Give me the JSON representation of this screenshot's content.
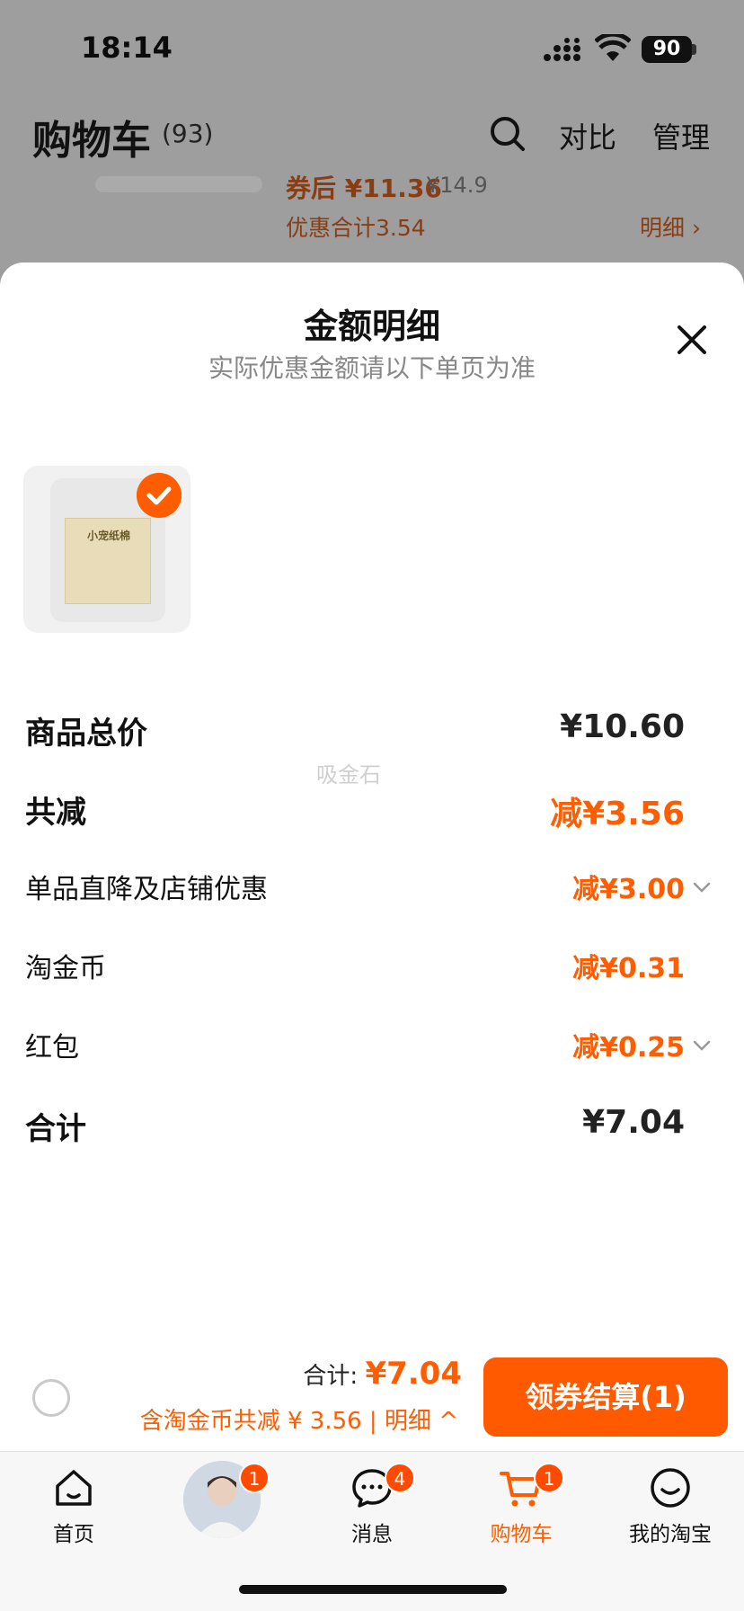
{
  "status_bar": {
    "time": "18:14",
    "battery": "90"
  },
  "background_page": {
    "title": "购物车",
    "count": "(93)",
    "compare_label": "对比",
    "manage_label": "管理",
    "coupon_price": "券后 ¥11.36",
    "original_price": "¥14.9",
    "discount_total": "优惠合计3.54",
    "detail_link": "明细 ›"
  },
  "sheet": {
    "title": "金额明细",
    "subtitle": "实际优惠金额请以下单页为准",
    "product": {
      "label": "小宠纸棉",
      "selected": true
    },
    "rows": [
      {
        "label": "商品总价",
        "value": "¥10.60",
        "emphasis": "bold"
      },
      {
        "label": "共减",
        "value": "减¥3.56",
        "emphasis": "bold-orange"
      },
      {
        "label": "单品直降及店铺优惠",
        "value": "减¥3.00",
        "expandable": true
      },
      {
        "label": "淘金币",
        "value": "减¥0.31",
        "expandable": false
      },
      {
        "label": "红包",
        "value": "减¥0.25",
        "expandable": true
      },
      {
        "label": "合计",
        "value": "¥7.04",
        "emphasis": "bold"
      }
    ],
    "watermark": "吸金石"
  },
  "checkout": {
    "total_label": "合计: ",
    "total_amount": "¥7.04",
    "savings_text": "含淘金币共减 ¥ 3.56 | 明细 ^",
    "button_label": "领券结算(1)"
  },
  "tabs": [
    {
      "label": "首页",
      "icon": "home-icon",
      "badge": ""
    },
    {
      "label": "",
      "icon": "avatar",
      "badge": "1"
    },
    {
      "label": "消息",
      "icon": "message-icon",
      "badge": "4"
    },
    {
      "label": "购物车",
      "icon": "cart-icon",
      "badge": "1",
      "active": true
    },
    {
      "label": "我的淘宝",
      "icon": "smile-icon",
      "badge": ""
    }
  ],
  "colors": {
    "accent": "#ff5d00",
    "overlay": "#9c9c9c",
    "sheet": "#ffffff"
  }
}
